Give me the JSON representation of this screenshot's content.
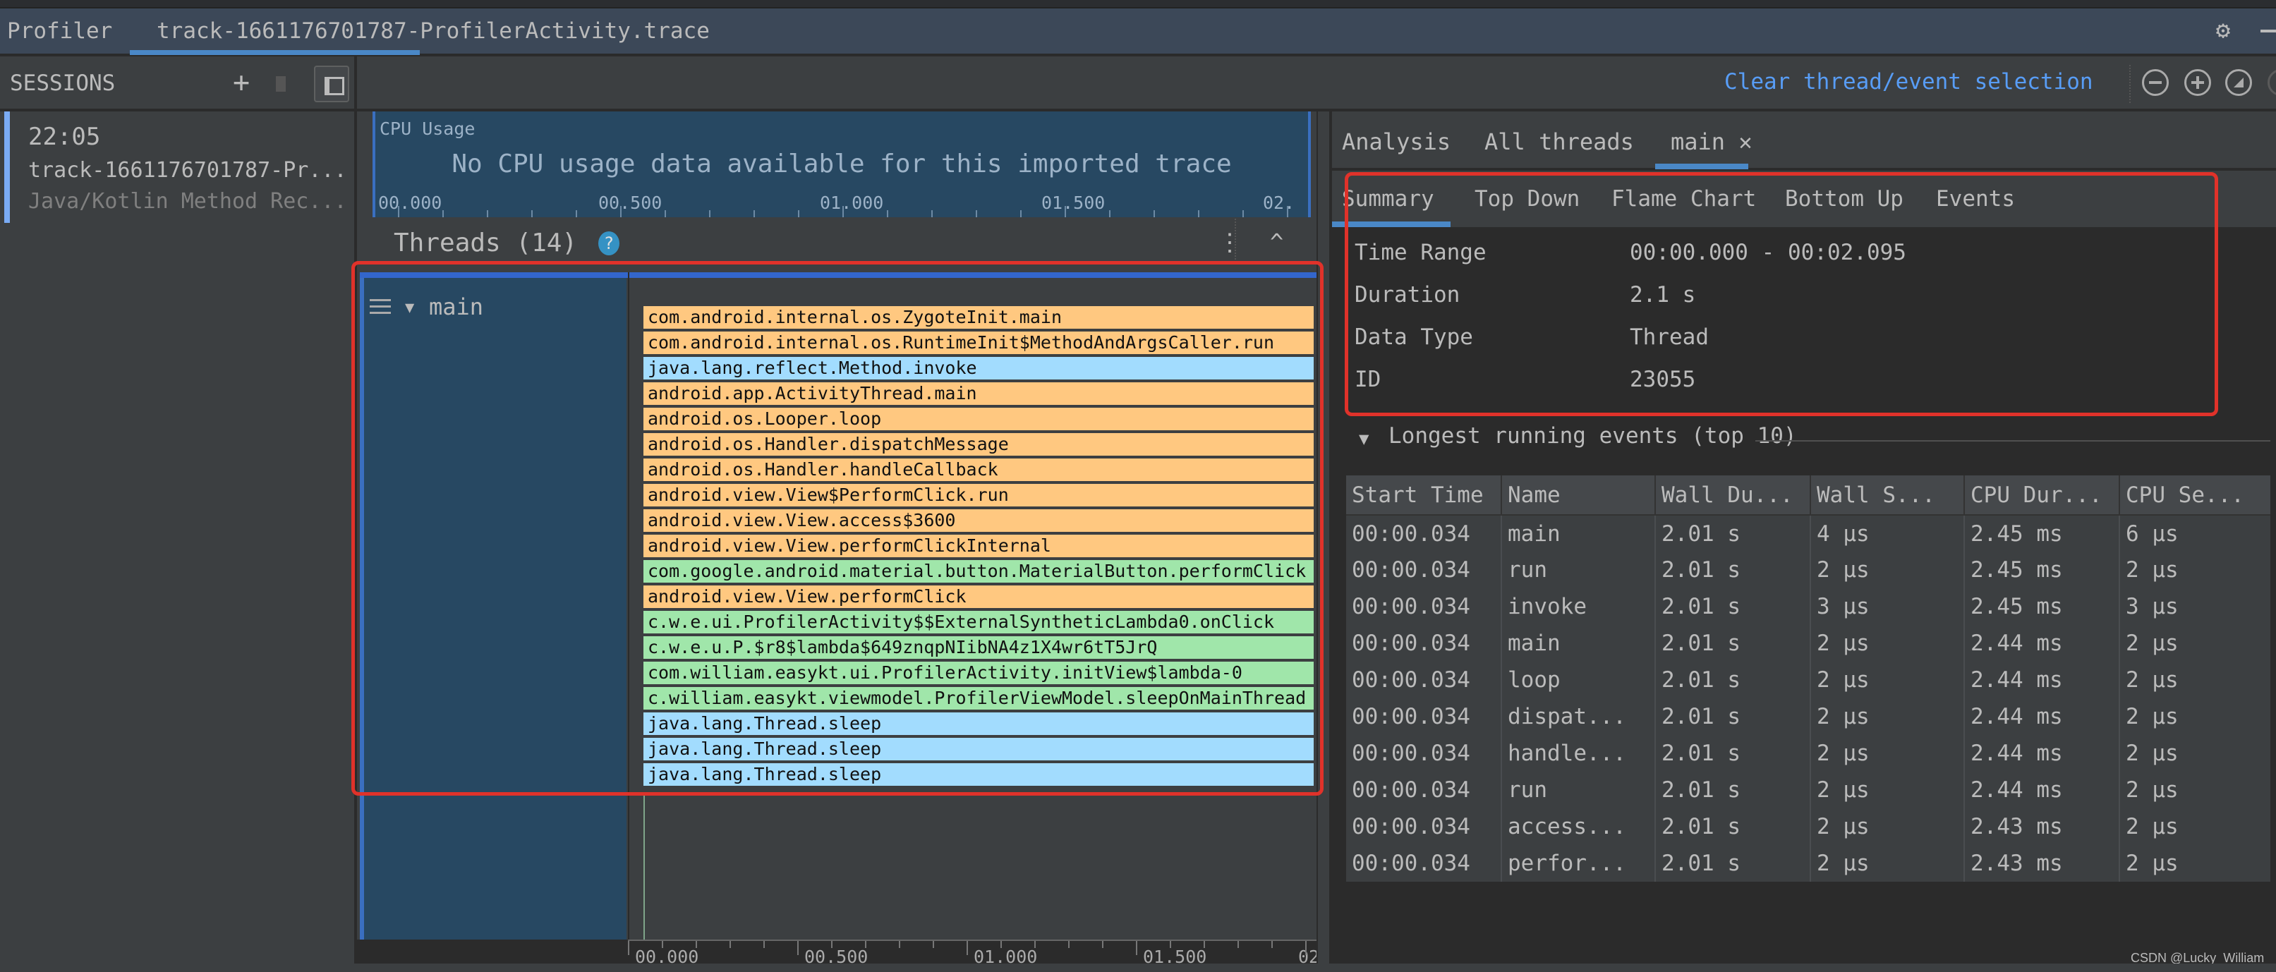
{
  "window": {
    "app_name": "Profiler",
    "tab_label": "track-1661176701787-ProfilerActivity.trace",
    "settings_icon": "gear-icon",
    "minimize_icon": "minimize-icon"
  },
  "sessions": {
    "header_label": "SESSIONS",
    "add_icon": "+",
    "items": [
      {
        "time": "22:05",
        "name": "track-1661176701787-Pr...",
        "type": "Java/Kotlin Method Rec..."
      }
    ]
  },
  "toolbar": {
    "clear_selection_label": "Clear thread/event selection",
    "icons": [
      "zoom-out-icon",
      "zoom-in-icon",
      "reset-zoom-icon",
      "frame-selection-icon"
    ]
  },
  "cpu_usage": {
    "label": "CPU Usage",
    "message": "No CPU usage data available for this imported trace",
    "ticks": [
      "00.000",
      "00.500",
      "01.000",
      "01.500",
      "02."
    ]
  },
  "threads": {
    "title": "Threads (14)",
    "help_icon": "?",
    "more_icon": "⋮",
    "collapse_icon": "^",
    "thread_name": "main",
    "call_chart": [
      {
        "label": "com.android.internal.os.ZygoteInit.main",
        "color": "orange"
      },
      {
        "label": "com.android.internal.os.RuntimeInit$MethodAndArgsCaller.run",
        "color": "orange"
      },
      {
        "label": "java.lang.reflect.Method.invoke",
        "color": "blue"
      },
      {
        "label": "android.app.ActivityThread.main",
        "color": "orange"
      },
      {
        "label": "android.os.Looper.loop",
        "color": "orange"
      },
      {
        "label": "android.os.Handler.dispatchMessage",
        "color": "orange"
      },
      {
        "label": "android.os.Handler.handleCallback",
        "color": "orange"
      },
      {
        "label": "android.view.View$PerformClick.run",
        "color": "orange"
      },
      {
        "label": "android.view.View.access$3600",
        "color": "orange"
      },
      {
        "label": "android.view.View.performClickInternal",
        "color": "orange"
      },
      {
        "label": "com.google.android.material.button.MaterialButton.performClick",
        "color": "green"
      },
      {
        "label": "android.view.View.performClick",
        "color": "orange"
      },
      {
        "label": "c.w.e.ui.ProfilerActivity$$ExternalSyntheticLambda0.onClick",
        "color": "green"
      },
      {
        "label": "c.w.e.u.P.$r8$lambda$649znqpNIibNA4z1X4wr6tT5JrQ",
        "color": "green"
      },
      {
        "label": "com.william.easykt.ui.ProfilerActivity.initView$lambda-0",
        "color": "green"
      },
      {
        "label": "c.william.easykt.viewmodel.ProfilerViewModel.sleepOnMainThread",
        "color": "green"
      },
      {
        "label": "java.lang.Thread.sleep",
        "color": "blue"
      },
      {
        "label": "java.lang.Thread.sleep",
        "color": "blue"
      },
      {
        "label": "java.lang.Thread.sleep",
        "color": "blue"
      }
    ],
    "axis_ticks": [
      "00.000",
      "00.500",
      "01.000",
      "01.500",
      "02."
    ]
  },
  "analysis": {
    "tabs": [
      {
        "label": "Analysis"
      },
      {
        "label": "All threads"
      },
      {
        "label": "main ✕",
        "active": true
      }
    ],
    "subtabs": [
      {
        "label": "Summary",
        "active": true
      },
      {
        "label": "Top Down"
      },
      {
        "label": "Flame Chart"
      },
      {
        "label": "Bottom Up"
      },
      {
        "label": "Events"
      }
    ],
    "summary": [
      {
        "key": "Time Range",
        "value": "00:00.000 - 00:02.095"
      },
      {
        "key": "Duration",
        "value": "2.1 s"
      },
      {
        "key": "Data Type",
        "value": "Thread"
      },
      {
        "key": "ID",
        "value": "23055"
      }
    ],
    "longest_title": "Longest running events (top 10)",
    "table": {
      "columns": [
        "Start Time",
        "Name",
        "Wall Du...",
        "Wall S...",
        "CPU Dur...",
        "CPU Se..."
      ],
      "rows": [
        [
          "00:00.034",
          "main",
          "2.01 s",
          "4 μs",
          "2.45 ms",
          "6 μs"
        ],
        [
          "00:00.034",
          "run",
          "2.01 s",
          "2 μs",
          "2.45 ms",
          "2 μs"
        ],
        [
          "00:00.034",
          "invoke",
          "2.01 s",
          "3 μs",
          "2.45 ms",
          "3 μs"
        ],
        [
          "00:00.034",
          "main",
          "2.01 s",
          "2 μs",
          "2.44 ms",
          "2 μs"
        ],
        [
          "00:00.034",
          "loop",
          "2.01 s",
          "2 μs",
          "2.44 ms",
          "2 μs"
        ],
        [
          "00:00.034",
          "dispat...",
          "2.01 s",
          "2 μs",
          "2.44 ms",
          "2 μs"
        ],
        [
          "00:00.034",
          "handle...",
          "2.01 s",
          "2 μs",
          "2.44 ms",
          "2 μs"
        ],
        [
          "00:00.034",
          "run",
          "2.01 s",
          "2 μs",
          "2.44 ms",
          "2 μs"
        ],
        [
          "00:00.034",
          "access...",
          "2.01 s",
          "2 μs",
          "2.43 ms",
          "2 μs"
        ],
        [
          "00:00.034",
          "perfor...",
          "2.01 s",
          "2 μs",
          "2.43 ms",
          "2 μs"
        ]
      ]
    }
  },
  "watermark": "CSDN @Lucky_William",
  "colors": {
    "accent": "#4a88c7",
    "link": "#589df6",
    "annotation_red": "#e0322a",
    "call_orange": "#ffc880",
    "call_blue": "#a2dcfe",
    "call_green": "#a0e6aa"
  }
}
